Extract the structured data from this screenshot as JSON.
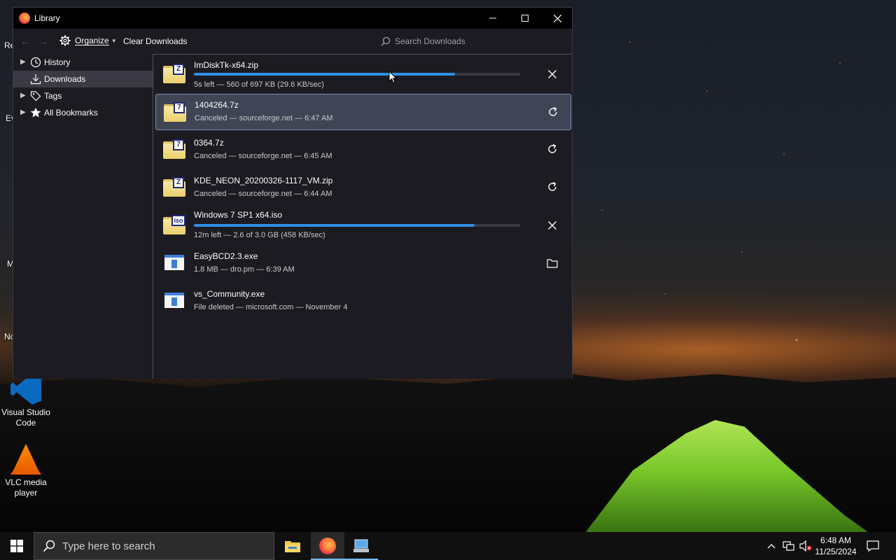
{
  "window": {
    "title": "Library"
  },
  "toolbar": {
    "organize_label": "Organize",
    "clear_label": "Clear Downloads",
    "search_placeholder": "Search Downloads"
  },
  "sidebar": {
    "items": [
      {
        "label": "History",
        "icon": "history-icon"
      },
      {
        "label": "Downloads",
        "icon": "download-icon"
      },
      {
        "label": "Tags",
        "icon": "tag-icon"
      },
      {
        "label": "All Bookmarks",
        "icon": "star-icon"
      }
    ]
  },
  "downloads": [
    {
      "name": "ImDiskTk-x64.zip",
      "status": "5s left — 560 of 697 KB (29.6 KB/sec)",
      "progress": 0.8,
      "icon_badge": "Z",
      "action": "cancel"
    },
    {
      "name": "1404264.7z",
      "status": "Canceled — sourceforge.net — 6:47 AM",
      "icon_badge": "7",
      "action": "retry"
    },
    {
      "name": "0364.7z",
      "status": "Canceled — sourceforge.net — 6:45 AM",
      "icon_badge": "7",
      "action": "retry"
    },
    {
      "name": "KDE_NEON_20200326-1117_VM.zip",
      "status": "Canceled — sourceforge.net — 6:44 AM",
      "icon_badge": "Z",
      "action": "retry"
    },
    {
      "name": "Windows 7 SP1 x64.iso",
      "status": "12m left — 2.6 of 3.0 GB (458 KB/sec)",
      "progress": 0.86,
      "icon_badge": "iso",
      "action": "cancel"
    },
    {
      "name": "EasyBCD2.3.exe",
      "status": "1.8 MB — dro.pm — 6:39 AM",
      "action": "show-in-folder"
    },
    {
      "name": "vs_Community.exe",
      "status": "File deleted — microsoft.com — November 4",
      "action": "none"
    }
  ],
  "desktop": {
    "vscode_label": "Visual Studio Code",
    "vlc_label": "VLC media player"
  },
  "taskbar": {
    "search_placeholder": "Type here to search",
    "time": "6:48 AM",
    "date": "11/25/2024"
  },
  "colors": {
    "accent": "#2e8fe6",
    "window_bg": "#1c1b22",
    "selected_bg": "#404555"
  }
}
